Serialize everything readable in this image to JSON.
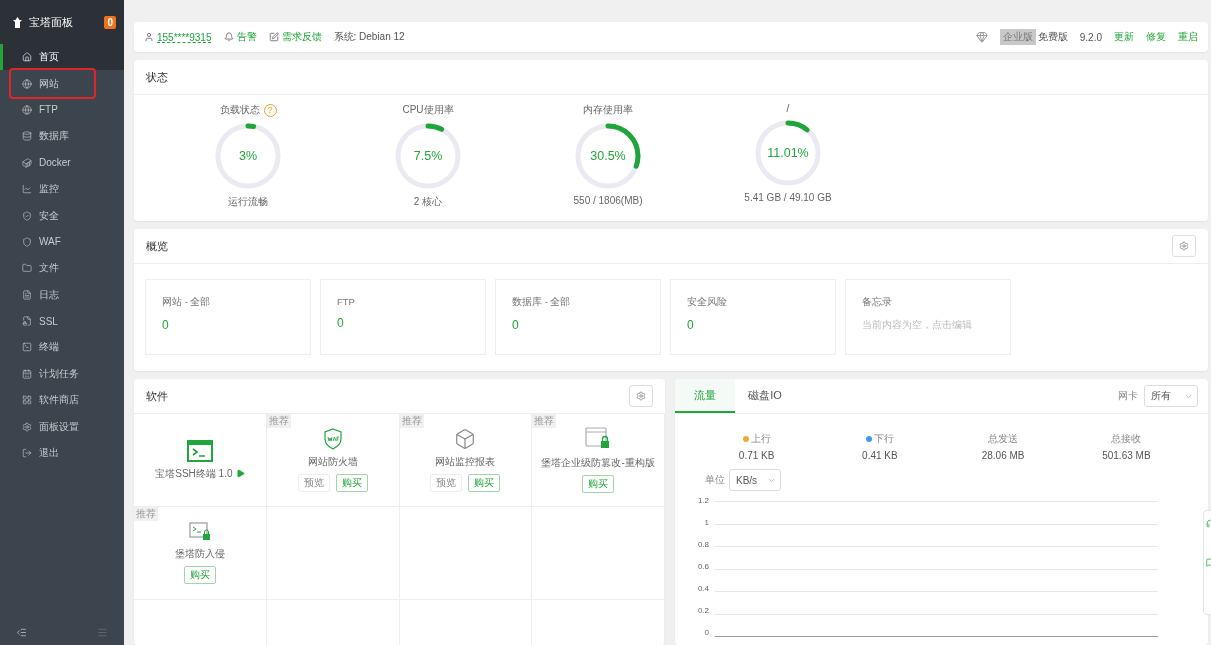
{
  "sidebar": {
    "title": "宝塔面板",
    "badge": "0",
    "items": [
      {
        "label": "首页",
        "selected": true,
        "highlighted": false
      },
      {
        "label": "网站",
        "selected": false,
        "highlighted": true
      },
      {
        "label": "FTP",
        "selected": false,
        "highlighted": false
      },
      {
        "label": "数据库",
        "selected": false,
        "highlighted": false
      },
      {
        "label": "Docker",
        "selected": false,
        "highlighted": false
      },
      {
        "label": "监控",
        "selected": false,
        "highlighted": false
      },
      {
        "label": "安全",
        "selected": false,
        "highlighted": false
      },
      {
        "label": "WAF",
        "selected": false,
        "highlighted": false
      },
      {
        "label": "文件",
        "selected": false,
        "highlighted": false
      },
      {
        "label": "日志",
        "selected": false,
        "highlighted": false
      },
      {
        "label": "SSL",
        "selected": false,
        "highlighted": false
      },
      {
        "label": "终端",
        "selected": false,
        "highlighted": false
      },
      {
        "label": "计划任务",
        "selected": false,
        "highlighted": false
      },
      {
        "label": "软件商店",
        "selected": false,
        "highlighted": false
      },
      {
        "label": "面板设置",
        "selected": false,
        "highlighted": false
      },
      {
        "label": "退出",
        "selected": false,
        "highlighted": false
      }
    ]
  },
  "topbar": {
    "user": "155****9315",
    "links": [
      "告警",
      "需求反馈"
    ],
    "system": "系统:  Debian 12",
    "edition_badge": "企业版",
    "edition": "免费版",
    "version": "9.2.0",
    "actions": [
      "更新",
      "修复",
      "重启"
    ]
  },
  "status": {
    "title": "状态",
    "gauges": [
      {
        "label": "负载状态",
        "help": "?",
        "value": "3%",
        "level": 0.03,
        "caption": "运行流畅"
      },
      {
        "label": "CPU使用率",
        "value": "7.5%",
        "level": 0.075,
        "caption": "2 核心"
      },
      {
        "label": "内存使用率",
        "value": "30.5%",
        "level": 0.305,
        "caption": "550 / 1806(MB)"
      },
      {
        "label": "/",
        "value": "11.01%",
        "level": 0.1101,
        "caption": "5.41 GB / 49.10 GB"
      }
    ]
  },
  "overview": {
    "title": "概览",
    "stats": [
      {
        "kind": "stat",
        "label": "网站 - 全部",
        "value": "0"
      },
      {
        "kind": "stat",
        "label": "FTP",
        "value": "0"
      },
      {
        "kind": "stat",
        "label": "数据库 - 全部",
        "value": "0"
      },
      {
        "kind": "stat",
        "label": "安全风险",
        "value": "0"
      },
      {
        "kind": "memo",
        "label": "备忘录",
        "value": "当前内容为空，点击编辑"
      }
    ]
  },
  "software": {
    "title": "软件",
    "items": [
      {
        "name": "宝塔SSH终端 1.0",
        "runnable": true
      },
      {
        "tag": "推荐",
        "name": "网站防火墙",
        "runnable": false,
        "buttons": [
          {
            "label": "预览",
            "kind": "plain"
          },
          {
            "label": "购买",
            "kind": "buy"
          }
        ]
      },
      {
        "tag": "推荐",
        "name": "网站监控报表",
        "runnable": false,
        "buttons": [
          {
            "label": "预览",
            "kind": "plain"
          },
          {
            "label": "购买",
            "kind": "buy"
          }
        ]
      },
      {
        "tag": "推荐",
        "name": "堡塔企业级防篡改-重构版",
        "runnable": false,
        "buttons": [
          {
            "label": "购买",
            "kind": "buy"
          }
        ]
      },
      {
        "tag": "推荐",
        "name": "堡塔防入侵",
        "runnable": false,
        "buttons": [
          {
            "label": "购买",
            "kind": "buy"
          }
        ]
      }
    ]
  },
  "traffic": {
    "tabs": [
      {
        "label": "流量",
        "selected": true
      },
      {
        "label": "磁盘IO",
        "selected": false
      }
    ],
    "nic_label": "网卡",
    "nic_value": "所有",
    "stats": [
      {
        "label": "上行",
        "color": "#f5a73b",
        "value": "0.71 KB"
      },
      {
        "label": "下行",
        "color": "#3d9bf5",
        "value": "0.41 KB"
      },
      {
        "label": "总发送",
        "value": "28.06 MB"
      },
      {
        "label": "总接收",
        "value": "501.63 MB"
      }
    ],
    "unit_label": "单位",
    "unit_value": "KB/s",
    "y_axis_labels": [
      "1.2",
      "1",
      "0.8",
      "0.6",
      "0.4",
      "0.2",
      "0"
    ]
  }
}
